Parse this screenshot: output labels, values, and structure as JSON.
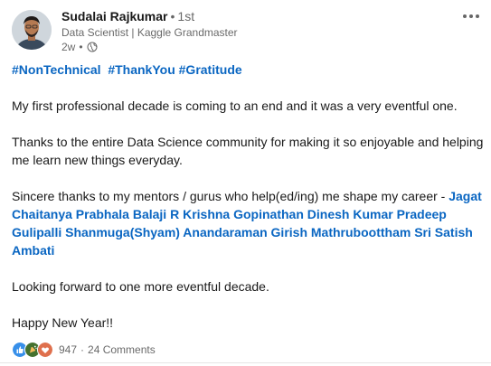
{
  "author": {
    "name": "Sudalai Rajkumar",
    "degree": "1st",
    "headline": "Data Scientist | Kaggle Grandmaster",
    "time": "2w"
  },
  "post": {
    "hashtags": [
      "#NonTechnical",
      "#ThankYou",
      "#Gratitude"
    ],
    "para1": "My first professional decade is coming to an end and it was a very eventful one.",
    "para2": "Thanks to the entire Data Science community for making it so enjoyable and helping me learn new things everyday.",
    "para3_prefix": "Sincere thanks to my mentors / gurus who help(ed/ing) me shape my career - ",
    "mentions": [
      "Jagat Chaitanya Prabhala",
      "Balaji R",
      "Krishna Gopinathan",
      "Dinesh Kumar",
      "Pradeep Gulipalli",
      "Shanmuga(Shyam) Anandaraman",
      "Girish Mathruboottham",
      "Sri Satish Ambati"
    ],
    "para4": "Looking forward to one more eventful decade.",
    "para5": "Happy New Year!!"
  },
  "social": {
    "reaction_count": "947",
    "comments": "24 Comments",
    "reaction_icons": [
      "like-icon",
      "celebrate-icon",
      "love-icon"
    ]
  },
  "colors": {
    "link": "#0a66c2",
    "like": "#378fe9",
    "celebrate": "#44712e",
    "love": "#df704d"
  }
}
